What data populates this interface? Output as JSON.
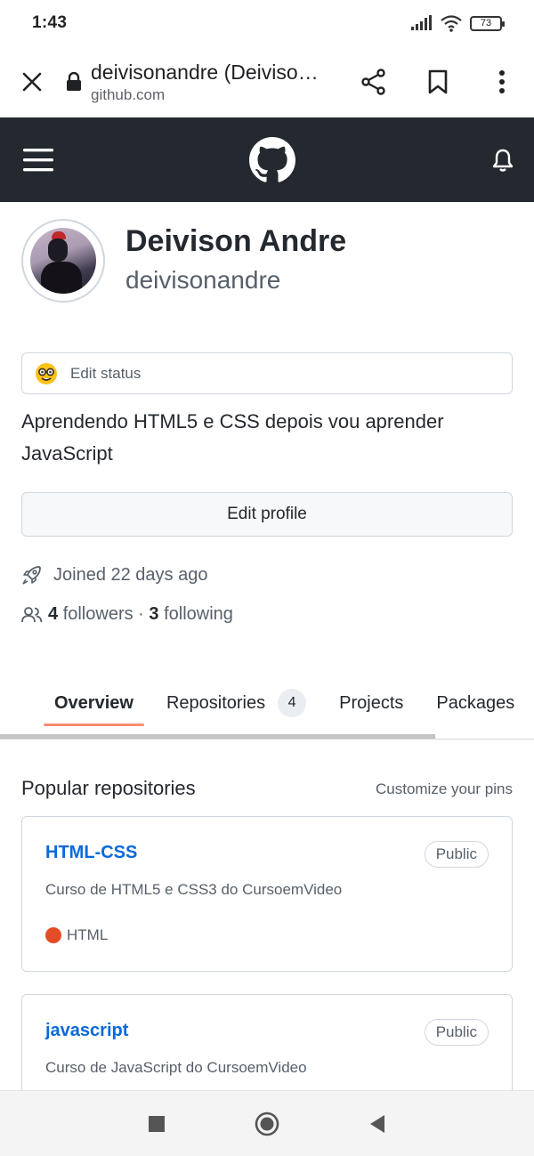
{
  "status_bar": {
    "time": "1:43",
    "battery": "73"
  },
  "browser": {
    "page_title": "deivisonandre (Deivison Andre)",
    "domain": "github.com"
  },
  "profile": {
    "name": "Deivison Andre",
    "login": "deivisonandre",
    "status_label": "Edit status",
    "bio": "Aprendendo HTML5 e CSS depois vou aprender JavaScript",
    "edit_button": "Edit profile",
    "joined": "Joined 22 days ago",
    "followers_count": "4",
    "followers_label": "followers",
    "separator": "·",
    "following_count": "3",
    "following_label": "following"
  },
  "tabs": [
    {
      "label": "Overview",
      "active": true
    },
    {
      "label": "Repositories",
      "count": "4"
    },
    {
      "label": "Projects"
    },
    {
      "label": "Packages"
    }
  ],
  "popular": {
    "title": "Popular repositories",
    "customize": "Customize your pins",
    "repos": [
      {
        "name": "HTML-CSS",
        "badge": "Public",
        "description": "Curso de HTML5 e CSS3 do CursoemVideo",
        "language": "HTML",
        "language_color": "#e34c26"
      },
      {
        "name": "javascript",
        "badge": "Public",
        "description": "Curso de JavaScript do CursoemVideo"
      }
    ]
  },
  "colors": {
    "header_bg": "#24292f",
    "link": "#0969da",
    "tab_underline": "#fd8c73"
  },
  "icons": [
    "close-icon",
    "lock-icon",
    "share-icon",
    "bookmark-icon",
    "more-vert-icon",
    "hamburger-menu-icon",
    "github-logo-icon",
    "bell-icon",
    "rocket-icon",
    "people-icon",
    "nerd-face-emoji-icon",
    "recents-icon",
    "home-icon",
    "back-icon"
  ]
}
